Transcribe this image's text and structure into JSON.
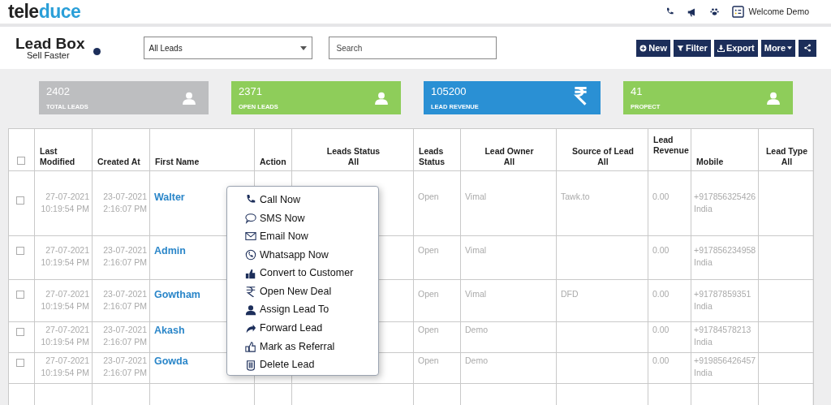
{
  "header": {
    "logo": [
      "tele",
      "duce"
    ],
    "user": "Welcome Demo"
  },
  "toolbar": {
    "title": "Lead Box",
    "subtitle": "Sell Faster",
    "view_select": "All Leads",
    "search": {
      "placeholder": "Search"
    },
    "buttons": [
      {
        "kind": "new",
        "label": "New"
      },
      {
        "kind": "filter",
        "label": "Filter"
      },
      {
        "kind": "export",
        "label": "Export"
      },
      {
        "kind": "more",
        "label": "More"
      },
      {
        "kind": "share"
      }
    ]
  },
  "stats": [
    {
      "value": "2402",
      "label": "TOTAL LEADS",
      "color": "#bdbec0",
      "kind": "user"
    },
    {
      "value": "2371",
      "label": "OPEN LEADS",
      "color": "#8ecd5a",
      "kind": "user"
    },
    {
      "value": "105200",
      "label": "LEAD REVENUE",
      "color": "#2a90d4",
      "kind": "rupee"
    },
    {
      "value": "41",
      "label": "PROPECT",
      "color": "#8ecd5a",
      "kind": "user"
    }
  ],
  "table": {
    "select_all_checked": false,
    "columns": [
      {
        "kind": "check"
      },
      {
        "kind": "text",
        "lines": [
          "Last",
          "Modified"
        ]
      },
      {
        "kind": "text",
        "lines": [
          "Created At"
        ]
      },
      {
        "kind": "text",
        "lines": [
          "First Name"
        ]
      },
      {
        "kind": "text",
        "lines": [
          "Action"
        ]
      },
      {
        "kind": "filter",
        "lines": [
          "Leads Status",
          "All"
        ]
      },
      {
        "kind": "text",
        "lines": [
          "Leads",
          "Status"
        ]
      },
      {
        "kind": "filter",
        "lines": [
          "Lead Owner",
          "All"
        ]
      },
      {
        "kind": "filter",
        "lines": [
          "Source of Lead",
          "All"
        ]
      },
      {
        "kind": "top",
        "lines": [
          "Lead",
          "Revenue"
        ]
      },
      {
        "kind": "text",
        "lines": [
          "Mobile"
        ]
      },
      {
        "kind": "filter",
        "lines": [
          "Lead Type",
          "All"
        ]
      }
    ],
    "rows": [
      {
        "checked": false,
        "modified": [
          "27-07-2021",
          "10:19:54 PM"
        ],
        "created": [
          "23-07-2021",
          "2:16:07 PM"
        ],
        "first_name": "Walter",
        "status": "Open",
        "owner": "Vimal",
        "source": "Tawk.to",
        "revenue": "0.00",
        "mobile": [
          "+917856325426",
          "India"
        ]
      },
      {
        "checked": false,
        "modified": [
          "27-07-2021",
          "10:19:54 PM"
        ],
        "created": [
          "23-07-2021",
          "2:16:07 PM"
        ],
        "first_name": "Admin",
        "status": "Open",
        "owner": "Vimal",
        "source": "",
        "revenue": "0.00",
        "mobile": [
          "+917856234958",
          "India"
        ]
      },
      {
        "checked": false,
        "modified": [
          "27-07-2021",
          "10:19:54 PM"
        ],
        "created": [
          "23-07-2021",
          "2:16:07 PM"
        ],
        "first_name": "Gowtham",
        "status": "Open",
        "owner": "Vimal",
        "source": "DFD",
        "revenue": "0.00",
        "mobile": [
          "+91787859351",
          "India"
        ]
      },
      {
        "checked": false,
        "modified": [
          "27-07-2021",
          "10:19:54 PM"
        ],
        "created": [
          "23-07-2021",
          "2:16:07 PM"
        ],
        "first_name": "Akash",
        "status": "Open",
        "owner": "Demo",
        "source": "",
        "revenue": "0.00",
        "mobile": [
          "+91784578213",
          "India"
        ]
      },
      {
        "checked": false,
        "modified": [
          "27-07-2021",
          "10:19:54 PM"
        ],
        "created": [
          "23-07-2021",
          "2:16:07 PM"
        ],
        "first_name": "Gowda",
        "status": "Open",
        "owner": "Demo",
        "source": "",
        "revenue": "0.00",
        "mobile": [
          "+919856426457",
          "India"
        ]
      }
    ]
  },
  "action_menu": [
    {
      "kind": "call",
      "label": "Call Now"
    },
    {
      "kind": "sms",
      "label": "SMS Now"
    },
    {
      "kind": "email",
      "label": "Email Now"
    },
    {
      "kind": "whatsapp",
      "label": "Whatsapp Now"
    },
    {
      "kind": "convert",
      "label": "Convert to Customer"
    },
    {
      "kind": "deal",
      "label": "Open New Deal"
    },
    {
      "kind": "assign",
      "label": "Assign Lead To"
    },
    {
      "kind": "forward",
      "label": "Forward Lead"
    },
    {
      "kind": "referral",
      "label": "Mark as Referral"
    },
    {
      "kind": "delete",
      "label": "Delete Lead"
    }
  ]
}
